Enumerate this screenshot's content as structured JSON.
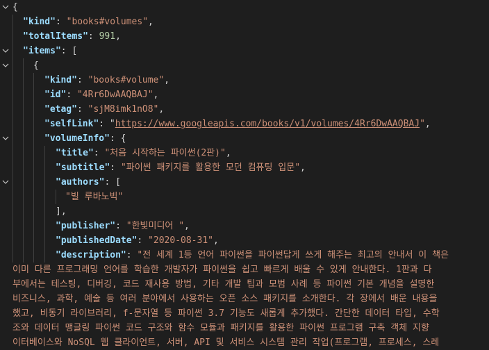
{
  "json": {
    "kind_key": "\"kind\"",
    "kind_value": "\"books#volumes\"",
    "totalItems_key": "\"totalItems\"",
    "totalItems_value": "991",
    "items_key": "\"items\"",
    "item": {
      "kind_key": "\"kind\"",
      "kind_value": "\"books#volume\"",
      "id_key": "\"id\"",
      "id_value": "\"4Rr6DwAAQBAJ\"",
      "etag_key": "\"etag\"",
      "etag_value": "\"sjM8imk1nO8\"",
      "selfLink_key": "\"selfLink\"",
      "selfLink_value": "https://www.googleapis.com/books/v1/volumes/4Rr6DwAAQBAJ",
      "volumeInfo_key": "\"volumeInfo\"",
      "title_key": "\"title\"",
      "title_value": "\"처음 시작하는 파이썬(2판)\"",
      "subtitle_key": "\"subtitle\"",
      "subtitle_value": "\"파이썬 패키지를 활용한 모던 컴퓨팅 입문\"",
      "authors_key": "\"authors\"",
      "author_0": "\"빌 루바노빅\"",
      "publisher_key": "\"publisher\"",
      "publisher_value": "\"한빛미디어 \"",
      "publishedDate_key": "\"publishedDate\"",
      "publishedDate_value": "\"2020-08-31\"",
      "description_key": "\"description\"",
      "description_line1": "\"전 세계 1등 언어 파이썬을 파이썬답게 쓰게 해주는 최고의 안내서 이 책은",
      "description_wrap": [
        "이미 다른 프로그래밍 언어를 학습한 개발자가 파이썬을 쉽고 빠르게 배울 수 있게 안내한다. 1판과 다",
        "부에서는 테스팅, 디버깅, 코드 재사용 방법, 기타 개발 팁과 모범 사례 등 파이썬 기본 개념을 설명한",
        "비즈니스, 과학, 예술 등 여러 분야에서 사용하는 오픈 소스 패키지를 소개한다. 각 장에서 배운 내용을",
        "했고, 비동기 라이브러리, f-문자열 등 파이썬 3.7 기능도 새롭게 추가했다. 간단한 데이터 타입, 수학",
        "조와 데이터 맹글링 파이썬 코드 구조와 함수 모듈과 패키지를 활용한 파이썬 프로그램 구축 객체 지향",
        "이터베이스와 NoSQL 웹 클라이언트, 서버, API 및 서비스 시스템 관리 작업(프로그램, 프로세스, 스레"
      ]
    }
  },
  "colors": {
    "background": "#1e1e1e",
    "key": "#9cdcfe",
    "string": "#ce9178",
    "number": "#b5cea8",
    "punctuation": "#d4d4d4"
  },
  "icons": {
    "fold": "chevron-down-icon"
  }
}
